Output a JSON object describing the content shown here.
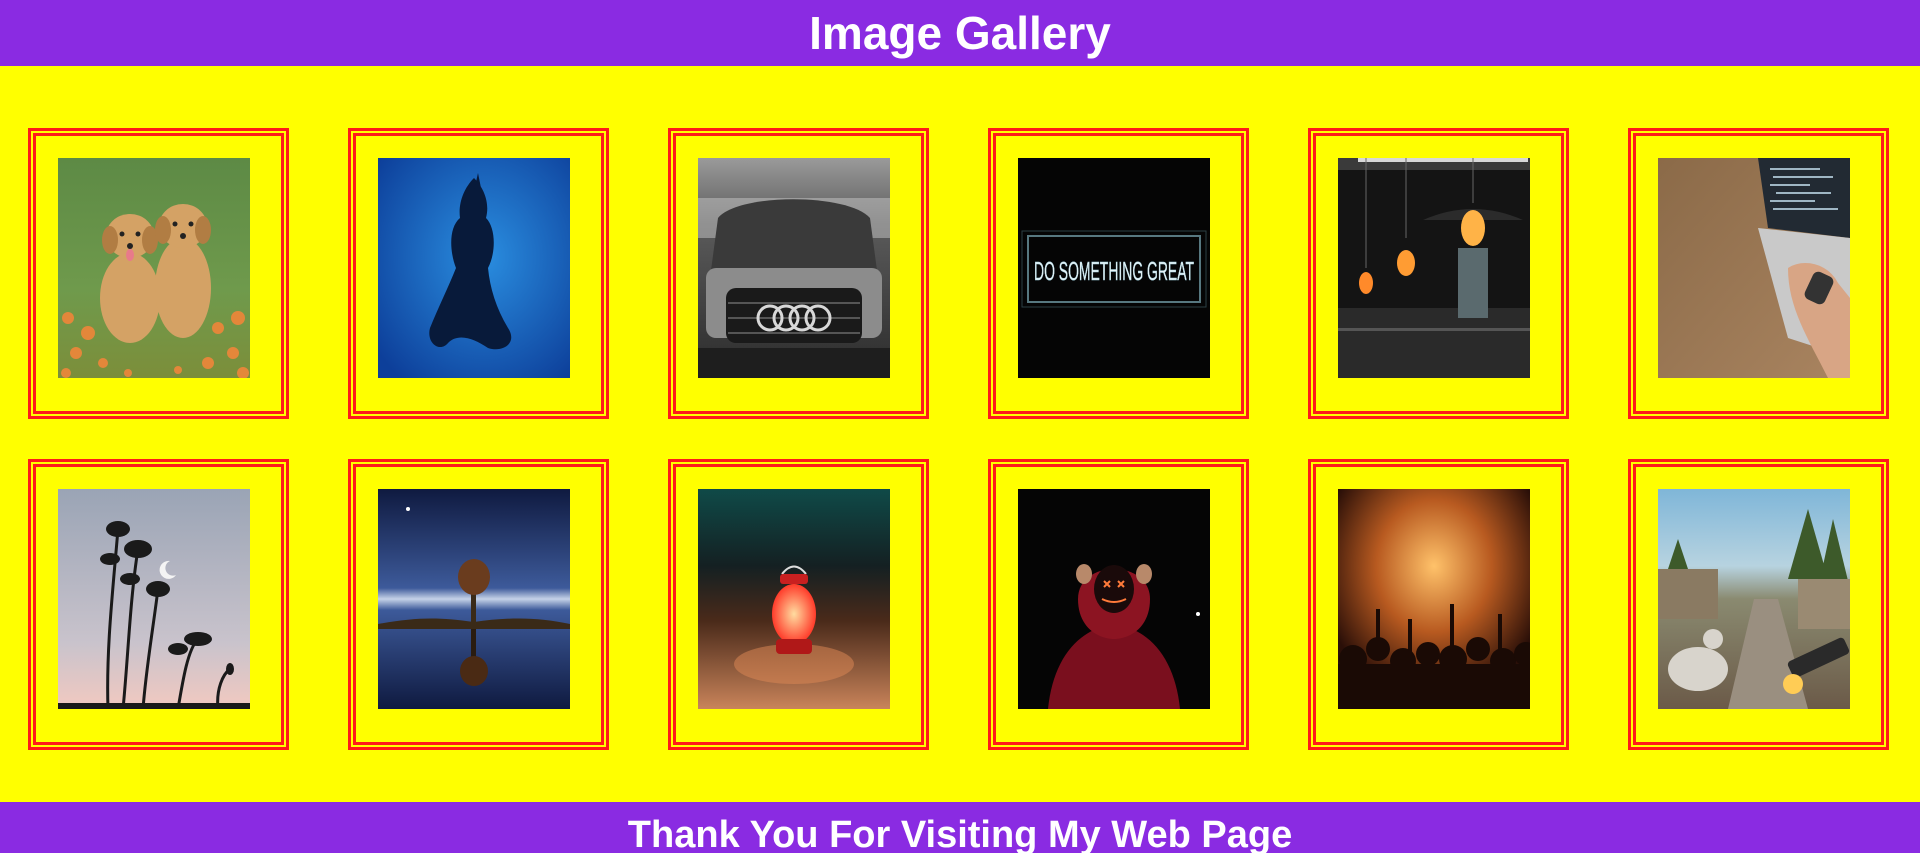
{
  "header": {
    "title": "Image Gallery"
  },
  "footer": {
    "text": "Thank You For Visiting My Web Page"
  },
  "colors": {
    "header_bg": "#8a2be2",
    "page_bg": "#ffff00",
    "frame_border": "#ff1a1a"
  },
  "gallery": {
    "images": [
      {
        "name": "puppies-image",
        "description": "two golden retriever puppies in a flower field"
      },
      {
        "name": "shiva-silhouette-image",
        "description": "black silhouette on blue background"
      },
      {
        "name": "audi-car-image",
        "description": "front grille of a car"
      },
      {
        "name": "neon-sign-image",
        "description": "neon sign",
        "text": "DO SOMETHING GREAT"
      },
      {
        "name": "hanging-lamps-image",
        "description": "hanging pendant lamps"
      },
      {
        "name": "laptop-typing-image",
        "description": "hand typing on laptop"
      },
      {
        "name": "trees-moon-image",
        "description": "tree silhouettes with crescent moon"
      },
      {
        "name": "lone-tree-reflection-image",
        "description": "lone tree reflected in water"
      },
      {
        "name": "lantern-sand-image",
        "description": "red lantern on sand"
      },
      {
        "name": "hooded-mask-image",
        "description": "person in red hoodie with neon mask"
      },
      {
        "name": "concert-crowd-image",
        "description": "concert crowd"
      },
      {
        "name": "game-scene-image",
        "description": "video game street scene"
      }
    ]
  }
}
